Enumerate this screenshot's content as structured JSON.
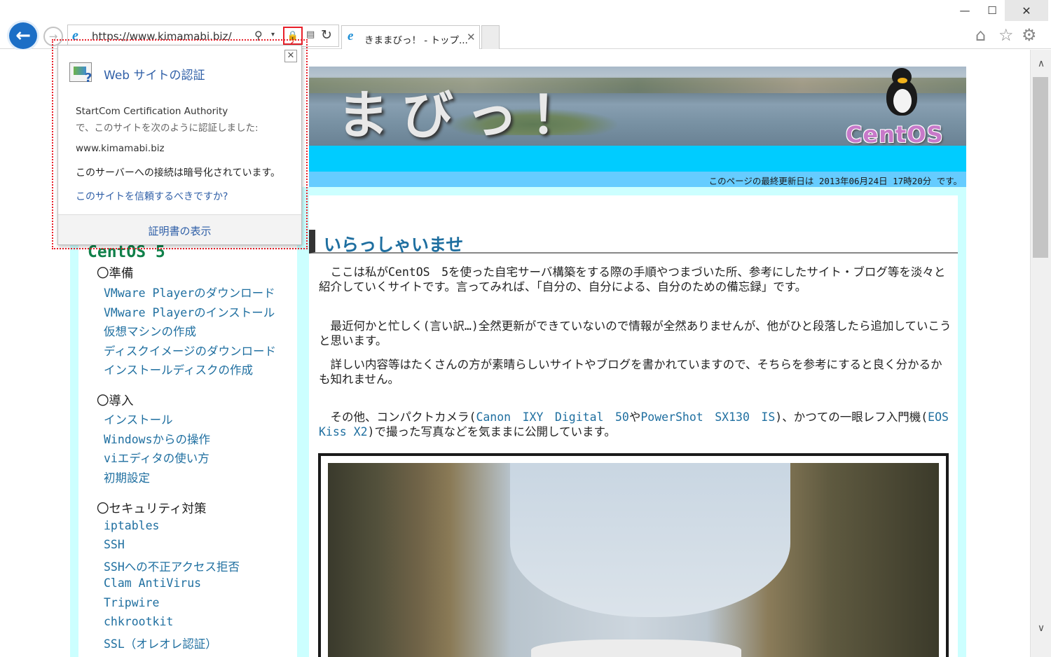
{
  "window": {
    "minimize_icon": "—",
    "maximize_icon": "☐",
    "close_icon": "✕"
  },
  "nav": {
    "back_icon": "←",
    "forward_icon": "→",
    "address_url": "https://www.kimamabi.biz/",
    "ie_logo": "e",
    "search_icon": "⚲",
    "dropdown_icon": "▾",
    "lock_icon": "🔒",
    "compat_icon": "▤",
    "refresh_icon": "↻"
  },
  "tab": {
    "title": "きままびっ！ - トップ...",
    "ie_logo": "e",
    "close_icon": "✕"
  },
  "toolbar": {
    "home_icon": "⌂",
    "favorites_icon": "☆",
    "settings_icon": "⚙"
  },
  "scrollbar": {
    "up_icon": "∧",
    "down_icon": "∨"
  },
  "page": {
    "banner_text": "まびっ！",
    "logo_text": "CentOS",
    "last_updated": "このページの最終更新日は 2013年06月24日 17時20分 です。",
    "welcome_heading": "いらっしゃいませ",
    "para1": "　ここは私がCentOS　5を使った自宅サーバ構築をする際の手順やつまづいた所、参考にしたサイト・ブログ等を淡々と紹介していくサイトです。言ってみれば、「自分の、自分による、自分のための備忘録」です。",
    "para2": "　最近何かと忙しく(言い訳…)全然更新ができていないので情報が全然ありませんが、他がひと段落したら追加していこうと思います。",
    "para3": "　詳しい内容等はたくさんの方が素晴らしいサイトやブログを書かれていますので、そちらを参考にすると良く分かるかも知れません。",
    "para4_a": "　その他、コンパクトカメラ(",
    "para4_link1": "Canon　IXY　Digital　50",
    "para4_b": "や",
    "para4_link2": "PowerShot　SX130　IS",
    "para4_c": ")、かつての一眼レフ入門機(",
    "para4_link3": "EOS Kiss X2",
    "para4_d": ")で撮った写真などを気ままに公開しています。"
  },
  "sidebar": {
    "title": "CentOS 5",
    "sections": [
      {
        "heading": "〇準備",
        "links": [
          "VMware Playerのダウンロード",
          "VMware Playerのインストール",
          "仮想マシンの作成",
          "ディスクイメージのダウンロード",
          "インストールディスクの作成"
        ]
      },
      {
        "heading": "〇導入",
        "links": [
          "インストール",
          "Windowsからの操作",
          "viエディタの使い方",
          "初期設定"
        ]
      },
      {
        "heading": "〇セキュリティ対策",
        "links": [
          "iptables",
          "SSH",
          "SSHへの不正アクセス拒否",
          "Clam AntiVirus",
          "Tripwire",
          "chkrootkit",
          "SSL（オレオレ認証）"
        ]
      }
    ]
  },
  "popup": {
    "close_icon": "✕",
    "title": "Web サイトの認証",
    "issuer": "StartCom Certification Authority",
    "issuer_desc": "で、このサイトを次のように認証しました:",
    "domain": "www.kimamabi.biz",
    "encrypted": "このサーバーへの接続は暗号化されています。",
    "trust_link": "このサイトを信頼するべきですか?",
    "cert_button": "証明書の表示"
  },
  "colors": {
    "accent_blue": "#1f6fa0",
    "header_cyan": "#00ccff",
    "update_band": "#66ccff",
    "highlight_red": "#e8202a",
    "sidebar_title_green": "#10804a"
  }
}
